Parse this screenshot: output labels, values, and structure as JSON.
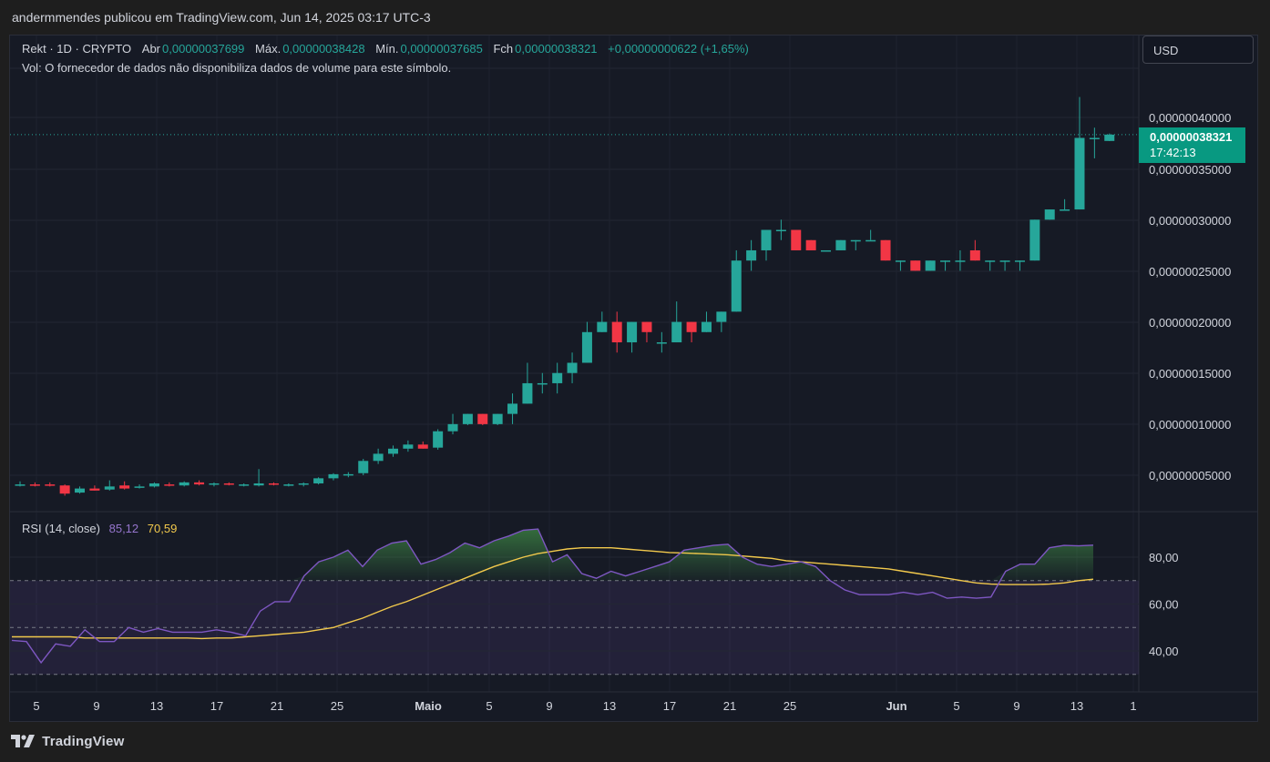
{
  "header": {
    "publisher": "andermmendes publicou em TradingView.com, Jun 14, 2025 03:17 UTC-3"
  },
  "legend": {
    "symbol": "Rekt · 1D · CRYPTO",
    "open_label": "Abr",
    "open": "0,00000037699",
    "high_label": "Máx.",
    "high": "0,00000038428",
    "low_label": "Mín.",
    "low": "0,00000037685",
    "close_label": "Fch",
    "close": "0,00000038321",
    "change": "+0,00000000622 (+1,65%)",
    "volume_note": "Vol: O fornecedor de dados não disponibiliza dados de volume para este símbolo."
  },
  "currency_button": "USD",
  "last_price": {
    "price": "0,00000038321",
    "countdown": "17:42:13"
  },
  "rsi_legend": {
    "label": "RSI (14, close)",
    "rsi_value": "85,12",
    "ma_value": "70,59"
  },
  "footer": {
    "brand": "TradingView"
  },
  "colors": {
    "up": "#26a69a",
    "down": "#f23645",
    "rsi": "#7e57c2",
    "rsi_ma": "#f2c94c",
    "background": "#161a25"
  },
  "chart_data": [
    {
      "type": "candlestick",
      "title": "Rekt · 1D · CRYPTO",
      "y_unit": "USD",
      "x_tick_labels": [
        "5",
        "9",
        "13",
        "17",
        "21",
        "25",
        "Maio",
        "5",
        "9",
        "13",
        "17",
        "21",
        "25",
        "Jun",
        "5",
        "9",
        "13",
        "1"
      ],
      "y_tick_labels": [
        "0,00000005000",
        "0,00000010000",
        "0,00000015000",
        "0,00000020000",
        "0,00000025000",
        "0,00000030000",
        "0,00000035000",
        "0,00000040000"
      ],
      "ylim": [
        0.0,
        4.5e-08
      ],
      "start_date": "2025-04-03",
      "candles": [
        {
          "o": 4.1e-09,
          "h": 4.4e-09,
          "l": 3.9e-09,
          "c": 4.1e-09
        },
        {
          "o": 4.1e-09,
          "h": 4.3e-09,
          "l": 3.9e-09,
          "c": 4e-09
        },
        {
          "o": 4.1e-09,
          "h": 4.3e-09,
          "l": 3.9e-09,
          "c": 4e-09
        },
        {
          "o": 4e-09,
          "h": 4.1e-09,
          "l": 3e-09,
          "c": 3.2e-09
        },
        {
          "o": 3.3e-09,
          "h": 3.9e-09,
          "l": 3.2e-09,
          "c": 3.7e-09
        },
        {
          "o": 3.7e-09,
          "h": 4e-09,
          "l": 3.5e-09,
          "c": 3.5e-09
        },
        {
          "o": 3.6e-09,
          "h": 4.5e-09,
          "l": 3.5e-09,
          "c": 3.9e-09
        },
        {
          "o": 4e-09,
          "h": 4.4e-09,
          "l": 3.6e-09,
          "c": 3.7e-09
        },
        {
          "o": 3.8e-09,
          "h": 4.1e-09,
          "l": 3.7e-09,
          "c": 3.9e-09
        },
        {
          "o": 3.9e-09,
          "h": 4.3e-09,
          "l": 3.8e-09,
          "c": 4.2e-09
        },
        {
          "o": 4.1e-09,
          "h": 4.3e-09,
          "l": 3.9e-09,
          "c": 4e-09
        },
        {
          "o": 4e-09,
          "h": 4.4e-09,
          "l": 3.9e-09,
          "c": 4.3e-09
        },
        {
          "o": 4.3e-09,
          "h": 4.5e-09,
          "l": 4e-09,
          "c": 4.1e-09
        },
        {
          "o": 4.1e-09,
          "h": 4.3e-09,
          "l": 3.9e-09,
          "c": 4.2e-09
        },
        {
          "o": 4.2e-09,
          "h": 4.3e-09,
          "l": 4e-09,
          "c": 4.1e-09
        },
        {
          "o": 4.1e-09,
          "h": 4.2e-09,
          "l": 3.9e-09,
          "c": 4.1e-09
        },
        {
          "o": 4e-09,
          "h": 5.6e-09,
          "l": 3.9e-09,
          "c": 4.2e-09
        },
        {
          "o": 4.2e-09,
          "h": 4.3e-09,
          "l": 4e-09,
          "c": 4.1e-09
        },
        {
          "o": 4.1e-09,
          "h": 4.2e-09,
          "l": 3.9e-09,
          "c": 4.1e-09
        },
        {
          "o": 4.1e-09,
          "h": 4.3e-09,
          "l": 3.9e-09,
          "c": 4.2e-09
        },
        {
          "o": 4.2e-09,
          "h": 4.8e-09,
          "l": 4.1e-09,
          "c": 4.7e-09
        },
        {
          "o": 4.7e-09,
          "h": 5.2e-09,
          "l": 4.5e-09,
          "c": 5.1e-09
        },
        {
          "o": 5.1e-09,
          "h": 5.3e-09,
          "l": 4.8e-09,
          "c": 5.1e-09
        },
        {
          "o": 5.2e-09,
          "h": 6.6e-09,
          "l": 5e-09,
          "c": 6.4e-09
        },
        {
          "o": 6.4e-09,
          "h": 7.6e-09,
          "l": 6.1e-09,
          "c": 7.1e-09
        },
        {
          "o": 7.1e-09,
          "h": 7.9e-09,
          "l": 6.8e-09,
          "c": 7.6e-09
        },
        {
          "o": 7.6e-09,
          "h": 8.4e-09,
          "l": 7.3e-09,
          "c": 8e-09
        },
        {
          "o": 8e-09,
          "h": 8.3e-09,
          "l": 7.6e-09,
          "c": 7.6e-09
        },
        {
          "o": 7.7e-09,
          "h": 9.5e-09,
          "l": 7.5e-09,
          "c": 9.3e-09
        },
        {
          "o": 9.3e-09,
          "h": 1.1e-08,
          "l": 9e-09,
          "c": 1e-08
        },
        {
          "o": 1e-08,
          "h": 1.1e-08,
          "l": 9.9e-09,
          "c": 1.1e-08
        },
        {
          "o": 1.1e-08,
          "h": 1.1e-08,
          "l": 9.9e-09,
          "c": 1e-08
        },
        {
          "o": 1e-08,
          "h": 1.1e-08,
          "l": 9.9e-09,
          "c": 1.1e-08
        },
        {
          "o": 1.1e-08,
          "h": 1.3e-08,
          "l": 1e-08,
          "c": 1.2e-08
        },
        {
          "o": 1.2e-08,
          "h": 1.6e-08,
          "l": 1.2e-08,
          "c": 1.4e-08
        },
        {
          "o": 1.4e-08,
          "h": 1.5e-08,
          "l": 1.3e-08,
          "c": 1.4e-08
        },
        {
          "o": 1.4e-08,
          "h": 1.6e-08,
          "l": 1.3e-08,
          "c": 1.5e-08
        },
        {
          "o": 1.5e-08,
          "h": 1.7e-08,
          "l": 1.4e-08,
          "c": 1.6e-08
        },
        {
          "o": 1.6e-08,
          "h": 2e-08,
          "l": 1.6e-08,
          "c": 1.9e-08
        },
        {
          "o": 1.9e-08,
          "h": 2.1e-08,
          "l": 1.9e-08,
          "c": 2e-08
        },
        {
          "o": 2e-08,
          "h": 2.1e-08,
          "l": 1.7e-08,
          "c": 1.8e-08
        },
        {
          "o": 1.8e-08,
          "h": 2e-08,
          "l": 1.7e-08,
          "c": 2e-08
        },
        {
          "o": 2e-08,
          "h": 2e-08,
          "l": 1.8e-08,
          "c": 1.9e-08
        },
        {
          "o": 1.8e-08,
          "h": 1.9e-08,
          "l": 1.7e-08,
          "c": 1.8e-08
        },
        {
          "o": 1.8e-08,
          "h": 2.2e-08,
          "l": 1.8e-08,
          "c": 2e-08
        },
        {
          "o": 2e-08,
          "h": 2e-08,
          "l": 1.8e-08,
          "c": 1.9e-08
        },
        {
          "o": 1.9e-08,
          "h": 2.1e-08,
          "l": 1.9e-08,
          "c": 2e-08
        },
        {
          "o": 2e-08,
          "h": 2.1e-08,
          "l": 1.9e-08,
          "c": 2.1e-08
        },
        {
          "o": 2.1e-08,
          "h": 2.7e-08,
          "l": 2.1e-08,
          "c": 2.6e-08
        },
        {
          "o": 2.6e-08,
          "h": 2.8e-08,
          "l": 2.5e-08,
          "c": 2.7e-08
        },
        {
          "o": 2.7e-08,
          "h": 2.9e-08,
          "l": 2.6e-08,
          "c": 2.9e-08
        },
        {
          "o": 2.9e-08,
          "h": 3e-08,
          "l": 2.8e-08,
          "c": 2.9e-08
        },
        {
          "o": 2.9e-08,
          "h": 2.9e-08,
          "l": 2.7e-08,
          "c": 2.7e-08
        },
        {
          "o": 2.8e-08,
          "h": 2.8e-08,
          "l": 2.7e-08,
          "c": 2.7e-08
        },
        {
          "o": 2.7e-08,
          "h": 2.7e-08,
          "l": 2.7e-08,
          "c": 2.7e-08
        },
        {
          "o": 2.7e-08,
          "h": 2.8e-08,
          "l": 2.7e-08,
          "c": 2.8e-08
        },
        {
          "o": 2.8e-08,
          "h": 2.8e-08,
          "l": 2.7e-08,
          "c": 2.8e-08
        },
        {
          "o": 2.8e-08,
          "h": 2.9e-08,
          "l": 2.8e-08,
          "c": 2.8e-08
        },
        {
          "o": 2.8e-08,
          "h": 2.8e-08,
          "l": 2.6e-08,
          "c": 2.6e-08
        },
        {
          "o": 2.6e-08,
          "h": 2.6e-08,
          "l": 2.5e-08,
          "c": 2.6e-08
        },
        {
          "o": 2.6e-08,
          "h": 2.6e-08,
          "l": 2.5e-08,
          "c": 2.5e-08
        },
        {
          "o": 2.5e-08,
          "h": 2.6e-08,
          "l": 2.5e-08,
          "c": 2.6e-08
        },
        {
          "o": 2.6e-08,
          "h": 2.6e-08,
          "l": 2.5e-08,
          "c": 2.6e-08
        },
        {
          "o": 2.6e-08,
          "h": 2.7e-08,
          "l": 2.5e-08,
          "c": 2.6e-08
        },
        {
          "o": 2.7e-08,
          "h": 2.8e-08,
          "l": 2.6e-08,
          "c": 2.6e-08
        },
        {
          "o": 2.6e-08,
          "h": 2.6e-08,
          "l": 2.5e-08,
          "c": 2.6e-08
        },
        {
          "o": 2.6e-08,
          "h": 2.6e-08,
          "l": 2.5e-08,
          "c": 2.6e-08
        },
        {
          "o": 2.6e-08,
          "h": 2.6e-08,
          "l": 2.5e-08,
          "c": 2.6e-08
        },
        {
          "o": 2.6e-08,
          "h": 3e-08,
          "l": 2.6e-08,
          "c": 3e-08
        },
        {
          "o": 3e-08,
          "h": 3.1e-08,
          "l": 3e-08,
          "c": 3.1e-08
        },
        {
          "o": 3.1e-08,
          "h": 3.2e-08,
          "l": 3.1e-08,
          "c": 3.1e-08
        },
        {
          "o": 3.1e-08,
          "h": 4.2e-08,
          "l": 3.1e-08,
          "c": 3.8e-08
        },
        {
          "o": 3.8e-08,
          "h": 3.9e-08,
          "l": 3.6e-08,
          "c": 3.8e-08
        },
        {
          "o": 3.7699e-08,
          "h": 3.8428e-08,
          "l": 3.7685e-08,
          "c": 3.8321e-08
        }
      ]
    },
    {
      "type": "line",
      "title": "RSI (14, close)",
      "ylim": [
        25,
        97
      ],
      "y_tick_labels": [
        "80,00",
        "60,00",
        "40,00"
      ],
      "bands": [
        30,
        50,
        70
      ],
      "series": [
        {
          "name": "RSI",
          "values": [
            44.5,
            44,
            35,
            43,
            42,
            49,
            44,
            44,
            50,
            48,
            49.5,
            48,
            48,
            48,
            49,
            48,
            46.5,
            57,
            61,
            61,
            72,
            78,
            80,
            83,
            76,
            83,
            86,
            87,
            77,
            79,
            82,
            86,
            84,
            87,
            89,
            91.5,
            92,
            78,
            81,
            73,
            71,
            74,
            72,
            74,
            76,
            78,
            83,
            84,
            85,
            85.5,
            80,
            77,
            76,
            77,
            78,
            76,
            70,
            66,
            64,
            64,
            64,
            65,
            64,
            65,
            62.5,
            63,
            62.5,
            63,
            74,
            77,
            77,
            84,
            85,
            84.8,
            85.12
          ]
        },
        {
          "name": "RSI-MA",
          "values": [
            46,
            46,
            46,
            46,
            46,
            45.5,
            45.5,
            45.5,
            45.5,
            45.5,
            45.5,
            45.5,
            45.5,
            45.3,
            45.5,
            45.5,
            46,
            46.5,
            47,
            47.5,
            48,
            49,
            50,
            52,
            54,
            56.5,
            59,
            61,
            63.5,
            66,
            68.5,
            71,
            73.5,
            76,
            78,
            80,
            81.5,
            82.5,
            83.5,
            84,
            84,
            84,
            83.5,
            83,
            82.5,
            82,
            81.8,
            81.5,
            81.3,
            81,
            80.5,
            80,
            79.5,
            78.5,
            78,
            77.5,
            77,
            76.5,
            76,
            75.5,
            75,
            74,
            73,
            72,
            71,
            70,
            69,
            68.5,
            68.3,
            68.3,
            68.3,
            68.5,
            69,
            70,
            70.59
          ]
        }
      ]
    }
  ]
}
